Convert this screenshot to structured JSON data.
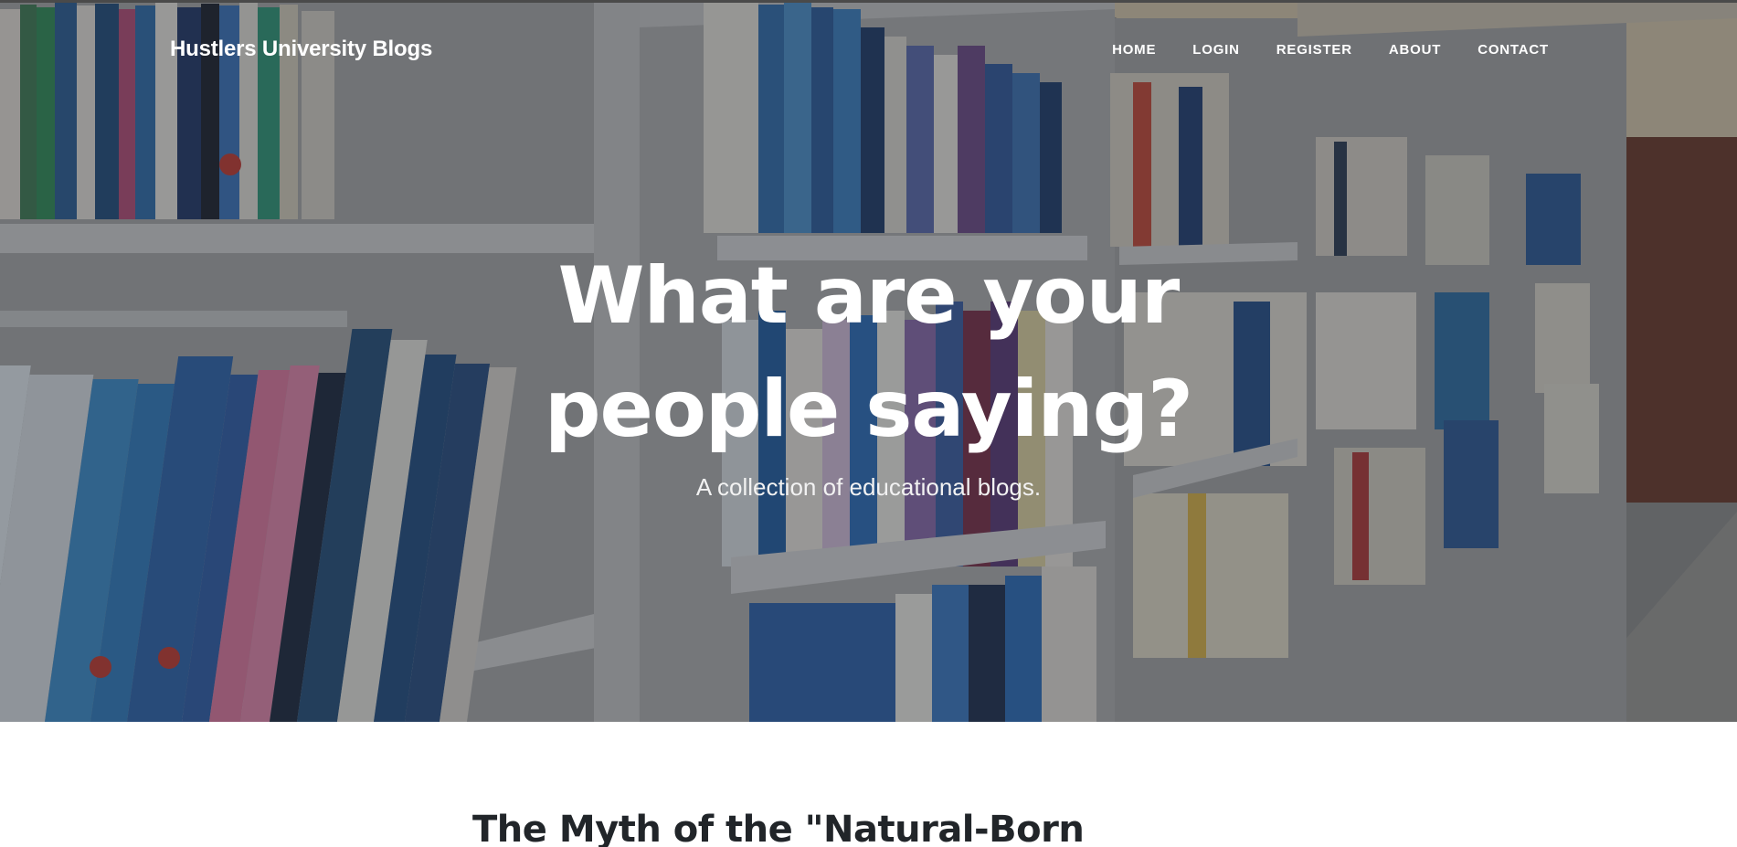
{
  "brand": "Hustlers University Blogs",
  "nav": {
    "home": "HOME",
    "login": "LOGIN",
    "register": "REGISTER",
    "about": "ABOUT",
    "contact": "CONTACT"
  },
  "hero": {
    "title": "What are your people saying?",
    "subtitle": "A collection of educational blogs."
  },
  "posts": [
    {
      "title": "The Myth of the \"Natural-Born"
    }
  ],
  "colors": {
    "overlay": "#23262a",
    "text_light": "#ffffff",
    "post_title": "#212529"
  }
}
